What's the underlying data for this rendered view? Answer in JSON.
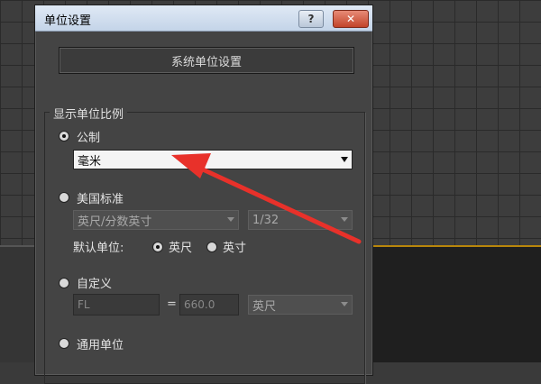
{
  "dialog": {
    "title": "单位设置",
    "help_label": "?",
    "close_label": "✕",
    "system_units_button": "系统单位设置",
    "display_scale": {
      "group_title": "显示单位比例",
      "metric": {
        "label": "公制",
        "selected": true,
        "unit_value": "毫米"
      },
      "us_standard": {
        "label": "美国标准",
        "unit_value": "英尺/分数英寸",
        "fraction_value": "1/32",
        "default_unit_label": "默认单位:",
        "feet_label": "英尺",
        "inches_label": "英寸"
      },
      "custom": {
        "label": "自定义",
        "name_value": "FL",
        "equals": "=",
        "amount_value": "660.0",
        "unit_value": "英尺"
      },
      "generic": {
        "label": "通用单位"
      }
    }
  },
  "colors": {
    "dialog_bg": "#444444",
    "annotation_arrow": "#e8312a"
  }
}
